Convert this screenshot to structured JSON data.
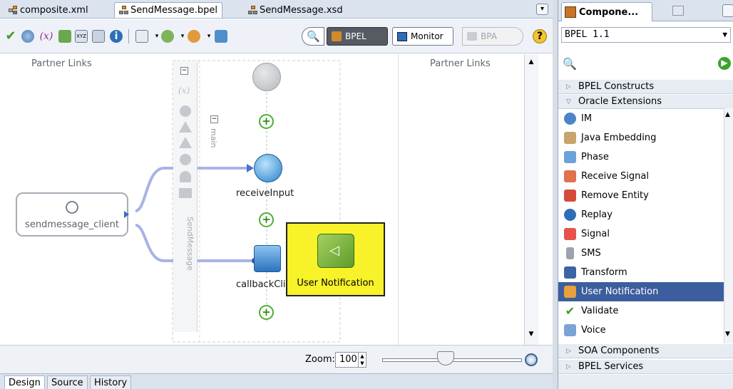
{
  "editor": {
    "tabs": [
      {
        "label": "composite.xml",
        "icon": "composite-icon"
      },
      {
        "label": "SendMessage.bpel",
        "icon": "bpel-file-icon"
      },
      {
        "label": "SendMessage.xsd",
        "icon": "xsd-file-icon"
      }
    ],
    "toolbar": {
      "bpel_label": "BPEL",
      "monitor_label": "Monitor",
      "bpa_label": "BPA"
    },
    "lanes": {
      "left_label": "Partner Links",
      "right_label": "Partner Links"
    },
    "scope": {
      "name": "main",
      "process_name": "SendMessage"
    },
    "partner_link": {
      "label": "sendmessage_client"
    },
    "activities": [
      {
        "label": "receiveInput"
      },
      {
        "label": "callbackClient"
      }
    ],
    "drag_tooltip": {
      "label": "User Notification"
    },
    "zoom": {
      "label": "Zoom:",
      "value": "100"
    },
    "bottom_tabs": [
      "Design",
      "Source",
      "History"
    ]
  },
  "palette": {
    "tab_label": "Compone...",
    "selector_value": "BPEL 1.1",
    "categories": {
      "bpel_constructs": "BPEL Constructs",
      "oracle_extensions": "Oracle Extensions",
      "soa_components": "SOA Components",
      "bpel_services": "BPEL Services"
    },
    "items": [
      {
        "label": "IM",
        "icon": "im-icon"
      },
      {
        "label": "Java Embedding",
        "icon": "java-cup-icon"
      },
      {
        "label": "Phase",
        "icon": "phase-icon"
      },
      {
        "label": "Receive Signal",
        "icon": "receive-signal-icon"
      },
      {
        "label": "Remove Entity",
        "icon": "remove-entity-icon"
      },
      {
        "label": "Replay",
        "icon": "replay-icon"
      },
      {
        "label": "Signal",
        "icon": "signal-icon"
      },
      {
        "label": "SMS",
        "icon": "sms-icon"
      },
      {
        "label": "Transform",
        "icon": "transform-icon"
      },
      {
        "label": "User Notification",
        "icon": "user-notification-icon",
        "selected": true
      },
      {
        "label": "Validate",
        "icon": "validate-icon"
      },
      {
        "label": "Voice",
        "icon": "voice-icon"
      }
    ]
  }
}
